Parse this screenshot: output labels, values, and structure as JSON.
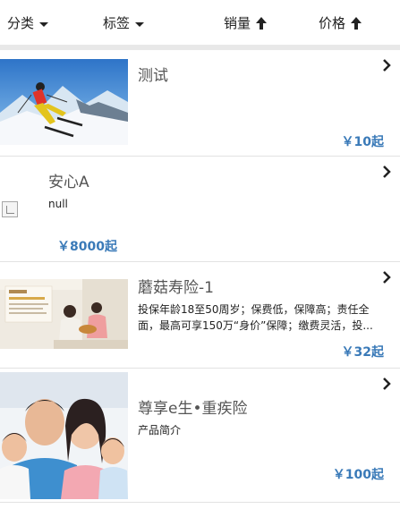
{
  "filters": {
    "category": "分类",
    "tags": "标签",
    "sales": "销量",
    "price": "价格"
  },
  "products": [
    {
      "title": "测试",
      "description": "",
      "price": "￥10起"
    },
    {
      "title": "安心A",
      "description": "null",
      "price": "￥8000起"
    },
    {
      "title": "蘑菇寿险-1",
      "description": "投保年龄18至50周岁；保费低，保障高；责任全面，最高可享150万“身价”保障；缴费灵活，投...",
      "price": "￥32起"
    },
    {
      "title": "尊享e生•重疾险",
      "description": "产品简介",
      "price": "￥100起"
    }
  ],
  "icons": {
    "filter_caret": "caret-down-icon",
    "sort_arrow": "arrow-up-icon",
    "row_chevron": "chevron-right-icon"
  },
  "colors": {
    "price": "#3a7ab8",
    "divider": "#e2e2e2"
  }
}
